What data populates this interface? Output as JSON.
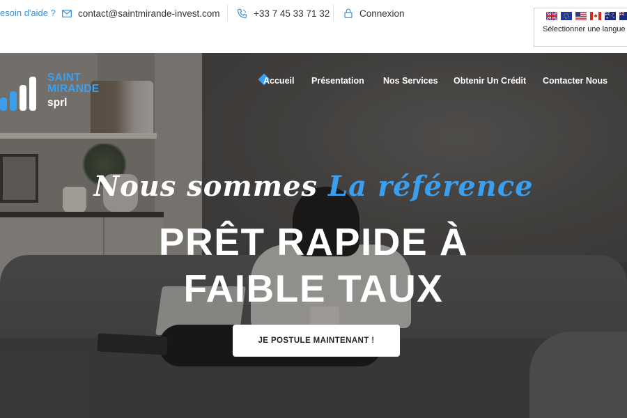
{
  "topbar": {
    "help_text": "esoin d'aide ?",
    "email": "contact@saintmirande-invest.com",
    "phone": "+33 7 45 33 71 32",
    "login": "Connexion"
  },
  "language": {
    "label": "Sélectionner une langue",
    "flags": [
      "uk-flag",
      "eu-flag",
      "us-flag",
      "canada-flag",
      "australia-flag",
      "new-zealand-flag"
    ]
  },
  "logo": {
    "line1": "SAINT",
    "line2": "MIRANDE",
    "line3": "sprl"
  },
  "nav": {
    "items": [
      "Accueil",
      "Présentation",
      "Nos Services",
      "Obtenir Un Crédit",
      "Contacter Nous"
    ],
    "active": "Accueil"
  },
  "hero": {
    "tagline_part1": "Nous sommes",
    "tagline_part2": "La référence",
    "headline_line1": "PRÊT RAPIDE À",
    "headline_line2": "FAIBLE TAUX",
    "cta": "JE POSTULE MAINTENANT !"
  },
  "colors": {
    "accent": "#3b9ff0",
    "white": "#ffffff",
    "text_dark": "#333333"
  }
}
